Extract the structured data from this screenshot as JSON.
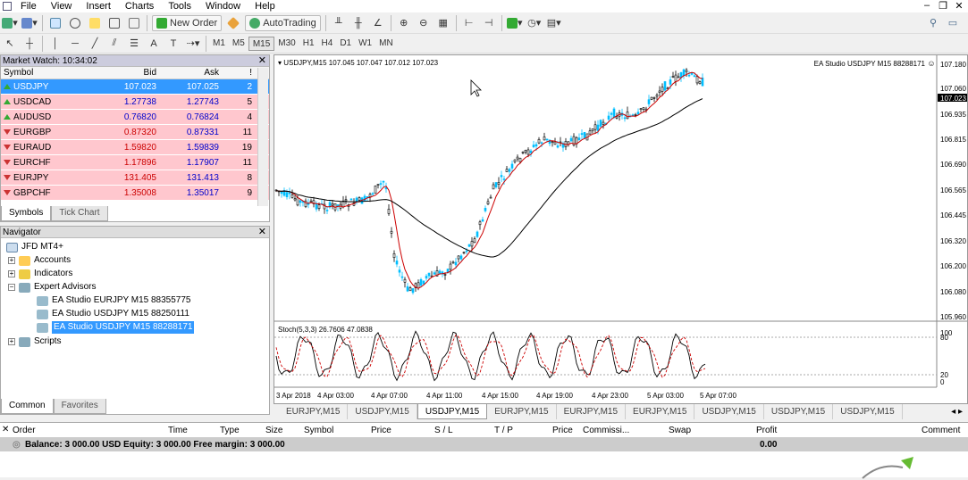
{
  "menu": [
    "File",
    "View",
    "Insert",
    "Charts",
    "Tools",
    "Window",
    "Help"
  ],
  "window_controls": [
    "–",
    "❐",
    "✕"
  ],
  "toolbar1": {
    "new_order": "New Order",
    "autotrading": "AutoTrading"
  },
  "timeframes": [
    "M1",
    "M5",
    "M15",
    "M30",
    "H1",
    "H4",
    "D1",
    "W1",
    "MN"
  ],
  "active_timeframe": "M15",
  "market_watch": {
    "title": "Market Watch: 10:34:02",
    "headers": {
      "symbol": "Symbol",
      "bid": "Bid",
      "ask": "Ask",
      "spread": "!"
    },
    "rows": [
      {
        "symbol": "USDJPY",
        "bid": "107.023",
        "ask": "107.025",
        "spread": "2",
        "dir": "up",
        "selected": true
      },
      {
        "symbol": "USDCAD",
        "bid": "1.27738",
        "ask": "1.27743",
        "spread": "5",
        "dir": "up"
      },
      {
        "symbol": "AUDUSD",
        "bid": "0.76820",
        "ask": "0.76824",
        "spread": "4",
        "dir": "up"
      },
      {
        "symbol": "EURGBP",
        "bid": "0.87320",
        "ask": "0.87331",
        "spread": "11",
        "dir": "down"
      },
      {
        "symbol": "EURAUD",
        "bid": "1.59820",
        "ask": "1.59839",
        "spread": "19",
        "dir": "down"
      },
      {
        "symbol": "EURCHF",
        "bid": "1.17896",
        "ask": "1.17907",
        "spread": "11",
        "dir": "down"
      },
      {
        "symbol": "EURJPY",
        "bid": "131.405",
        "ask": "131.413",
        "spread": "8",
        "dir": "down"
      },
      {
        "symbol": "GBPCHF",
        "bid": "1.35008",
        "ask": "1.35017",
        "spread": "9",
        "dir": "down"
      }
    ],
    "tabs": [
      "Symbols",
      "Tick Chart"
    ]
  },
  "navigator": {
    "title": "Navigator",
    "root": "JFD MT4+",
    "items": [
      "Accounts",
      "Indicators",
      "Expert Advisors",
      "Scripts"
    ],
    "experts": [
      "EA Studio EURJPY M15 88355775",
      "EA Studio USDJPY M15 88250111",
      "EA Studio USDJPY M15 88288171"
    ],
    "tabs": [
      "Common",
      "Favorites"
    ]
  },
  "chart": {
    "header": "USDJPY,M15  107.045 107.047 107.012 107.023",
    "ea_label": "EA Studio USDJPY M15 88288171",
    "price_labels": [
      "107.180",
      "107.060",
      "106.935",
      "106.815",
      "106.690",
      "106.565",
      "106.445",
      "106.320",
      "106.200",
      "106.080",
      "105.960"
    ],
    "current_price": "107.023",
    "stoch_header": "Stoch(5,3,3) 26.7606 47.0838",
    "stoch_levels": [
      "100",
      "80",
      "20",
      "0"
    ],
    "time_labels": [
      "3 Apr 2018",
      "4 Apr 03:00",
      "4 Apr 07:00",
      "4 Apr 11:00",
      "4 Apr 15:00",
      "4 Apr 19:00",
      "4 Apr 23:00",
      "5 Apr 03:00",
      "5 Apr 07:00"
    ],
    "colors": {
      "up": "#00bfff",
      "down": "#000000",
      "ma_fast": "#cc0000",
      "ma_slow": "#000000"
    }
  },
  "chart_tabs": [
    "EURJPY,M15",
    "USDJPY,M15",
    "USDJPY,M15",
    "EURJPY,M15",
    "EURJPY,M15",
    "EURJPY,M15",
    "USDJPY,M15",
    "USDJPY,M15",
    "USDJPY,M15"
  ],
  "active_chart_tab": 2,
  "terminal": {
    "headers": [
      "Order",
      "Time",
      "Type",
      "Size",
      "Symbol",
      "Price",
      "S / L",
      "T / P",
      "Price",
      "Commissi...",
      "Swap",
      "Profit",
      "Comment"
    ],
    "balance": "Balance: 3 000.00 USD  Equity: 3 000.00  Free margin: 3 000.00",
    "profit": "0.00"
  }
}
